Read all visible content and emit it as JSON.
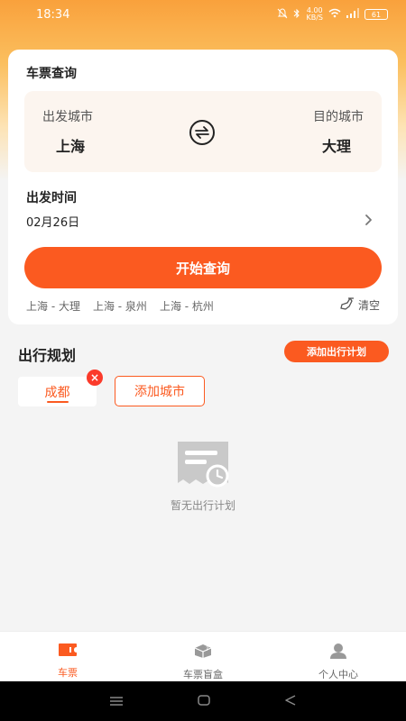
{
  "status_bar": {
    "time": "18:34",
    "network_speed_value": "4.00",
    "network_speed_unit": "KB/S",
    "battery": "61"
  },
  "query": {
    "title": "车票查询",
    "from_label": "出发城市",
    "from_city": "上海",
    "to_label": "目的城市",
    "to_city": "大理",
    "date_label": "出发时间",
    "date_value": "02月26日",
    "search_button": "开始查询",
    "history": [
      "上海 - 大理",
      "上海 - 泉州",
      "上海 - 杭州"
    ],
    "clear_label": "清空"
  },
  "plan": {
    "title": "出行规划",
    "add_plan_button": "添加出行计划",
    "city_tab": "成都",
    "add_city_button": "添加城市",
    "empty_text": "暂无出行计划"
  },
  "tabbar": {
    "items": [
      {
        "label": "车票",
        "icon": "ticket-icon",
        "active": true
      },
      {
        "label": "车票盲盒",
        "icon": "blind-box-icon",
        "active": false
      },
      {
        "label": "个人中心",
        "icon": "person-icon",
        "active": false
      }
    ]
  },
  "colors": {
    "accent": "#fb5a20",
    "header_gradient_top": "#f9a13c"
  }
}
